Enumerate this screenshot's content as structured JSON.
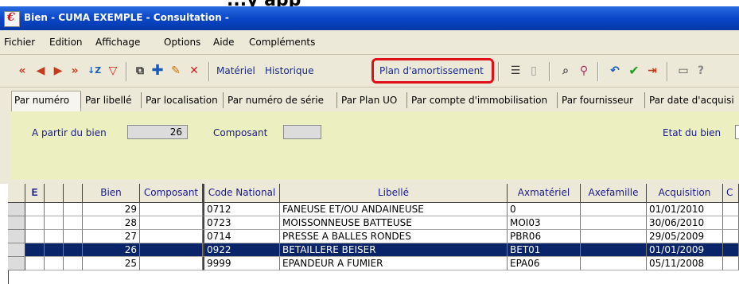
{
  "header_text": "...y app",
  "window": {
    "title": "Bien - CUMA EXEMPLE - Consultation -",
    "icon": "app-logo-icon"
  },
  "menu": [
    "Fichier",
    "Edition",
    "Affichage",
    "Options",
    "Aide",
    "Compléments"
  ],
  "toolbar": {
    "materiel": "Matériel",
    "historique": "Historique",
    "plan": "Plan d'amortissement",
    "highlight_color": "#e0101a"
  },
  "tabs": [
    "Par numéro",
    "Par libellé",
    "Par localisation",
    "Par numéro de série",
    "Par Plan UO",
    "Par compte d'immobilisation",
    "Par fournisseur",
    "Par date d'acquisi"
  ],
  "filter": {
    "a_partir_label": "A partir du bien",
    "a_partir_value": "26",
    "composant_label": "Composant",
    "composant_value": "",
    "etat_label": "Etat du bien"
  },
  "grid": {
    "headers": [
      "",
      "",
      "",
      "Bien",
      "Composant",
      "Code National",
      "Libellé",
      "Axmatériel",
      "Axefamille",
      "Acquisition",
      "C"
    ],
    "rows": [
      {
        "bien": "29",
        "composant": "",
        "code": "0712",
        "libelle": "FANEUSE ET/OU ANDAINEUSE",
        "axmateriel": "0",
        "axefamille": "",
        "acquisition": "01/01/2010",
        "selected": false
      },
      {
        "bien": "28",
        "composant": "",
        "code": "0723",
        "libelle": "MOISSONNEUSE BATTEUSE",
        "axmateriel": "MOI03",
        "axefamille": "",
        "acquisition": "30/06/2010",
        "selected": false
      },
      {
        "bien": "27",
        "composant": "",
        "code": "0714",
        "libelle": "PRESSE A BALLES RONDES",
        "axmateriel": "PBR06",
        "axefamille": "",
        "acquisition": "29/05/2009",
        "selected": false
      },
      {
        "bien": "26",
        "composant": "",
        "code": "0922",
        "libelle": "BETAILLERE BEISER",
        "axmateriel": "BET01",
        "axefamille": "",
        "acquisition": "01/01/2009",
        "selected": true
      },
      {
        "bien": "25",
        "composant": "",
        "code": "9999",
        "libelle": "EPANDEUR A FUMIER",
        "axmateriel": "EPA06",
        "axefamille": "",
        "acquisition": "05/11/2008",
        "selected": false
      }
    ]
  },
  "colors": {
    "titlebar": "#0a46c8",
    "selected_row": "#0a246a",
    "filter_bg": "#ecf0c0"
  }
}
